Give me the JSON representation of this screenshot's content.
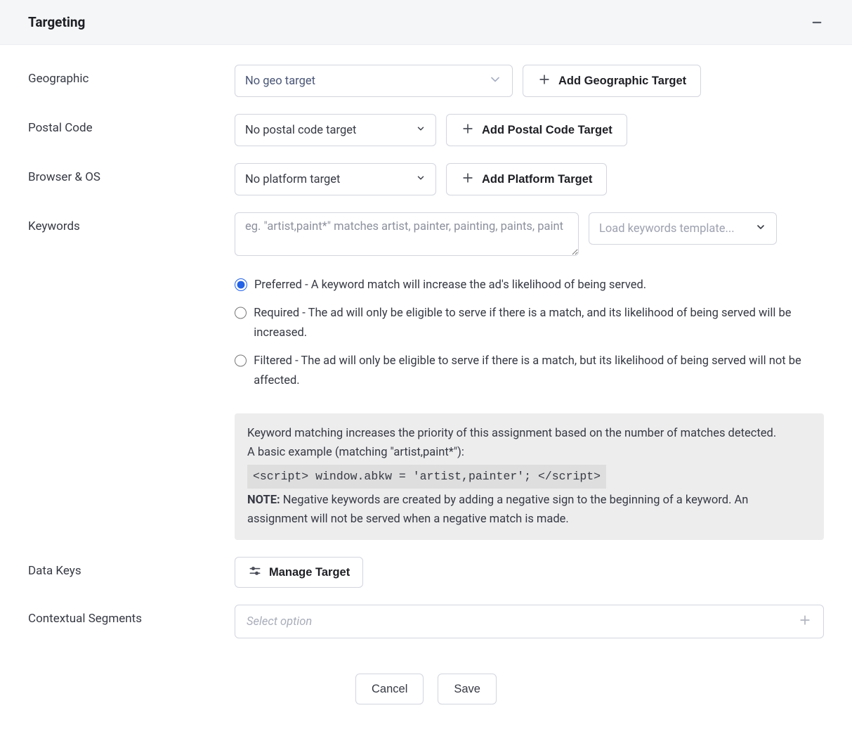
{
  "panel": {
    "title": "Targeting"
  },
  "geographic": {
    "label": "Geographic",
    "select_value": "No geo target",
    "add_button": "Add Geographic Target"
  },
  "postal": {
    "label": "Postal Code",
    "select_value": "No postal code target",
    "add_button": "Add Postal Code Target"
  },
  "browser_os": {
    "label": "Browser & OS",
    "select_value": "No platform target",
    "add_button": "Add Platform Target"
  },
  "keywords": {
    "label": "Keywords",
    "placeholder": "eg. \"artist,paint*\" matches artist, painter, painting, paints, paint",
    "template_button": "Load keywords template...",
    "radio_preferred": "Preferred - A keyword match will increase the ad's likelihood of being served.",
    "radio_required": "Required - The ad will only be eligible to serve if there is a match, and its likelihood of being served will be increased.",
    "radio_filtered": "Filtered - The ad will only be eligible to serve if there is a match, but its likelihood of being served will not be affected.",
    "info_line1": "Keyword matching increases the priority of this assignment based on the number of matches detected.",
    "info_line2": "A basic example (matching \"artist,paint*\"):",
    "info_code": "<script> window.abkw = 'artist,painter'; </script>",
    "info_note_label": "NOTE:",
    "info_note_text": " Negative keywords are created by adding a negative sign to the beginning of a keyword. An assignment will not be served when a negative match is made."
  },
  "data_keys": {
    "label": "Data Keys",
    "button": "Manage Target"
  },
  "contextual": {
    "label": "Contextual Segments",
    "placeholder": "Select option"
  },
  "footer": {
    "cancel": "Cancel",
    "save": "Save"
  }
}
